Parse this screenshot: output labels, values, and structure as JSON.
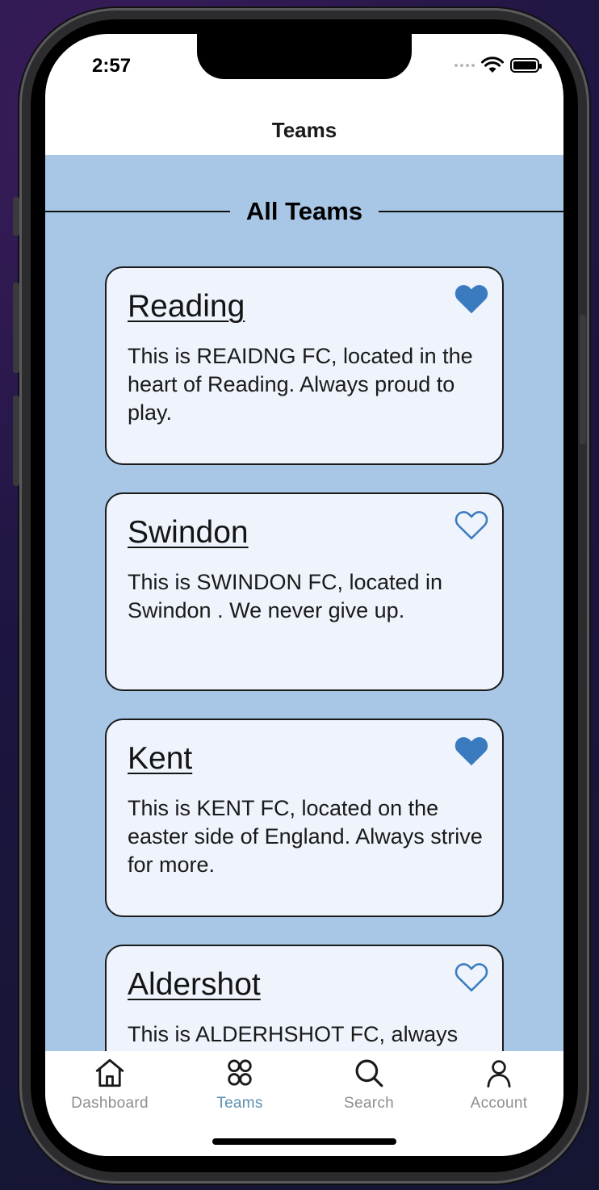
{
  "status": {
    "time": "2:57"
  },
  "header": {
    "title": "Teams"
  },
  "section": {
    "title": "All Teams"
  },
  "teams": [
    {
      "name": "Reading",
      "description": "This is REAIDNG FC, located in the heart of Reading. Always proud to play.",
      "favorited": true
    },
    {
      "name": "Swindon",
      "description": "This is SWINDON FC, located in Swindon . We never give up.",
      "favorited": false
    },
    {
      "name": "Kent",
      "description": "This is KENT FC, located on the easter side of England. Always strive for more.",
      "favorited": true
    },
    {
      "name": "Aldershot",
      "description": "This is ALDERHSHOT FC, always",
      "favorited": false
    }
  ],
  "tabbar": {
    "tabs": [
      {
        "label": "Dashboard",
        "icon": "home-icon",
        "active": false
      },
      {
        "label": "Teams",
        "icon": "teams-icon",
        "active": true
      },
      {
        "label": "Search",
        "icon": "search-icon",
        "active": false
      },
      {
        "label": "Account",
        "icon": "person-icon",
        "active": false
      }
    ]
  },
  "colors": {
    "accent": "#3a7bbf",
    "active_tab": "#5b8fb0",
    "inactive_tab": "#8e8e93",
    "content_background": "#a8c6e6",
    "card_background": "#eef3fc"
  }
}
